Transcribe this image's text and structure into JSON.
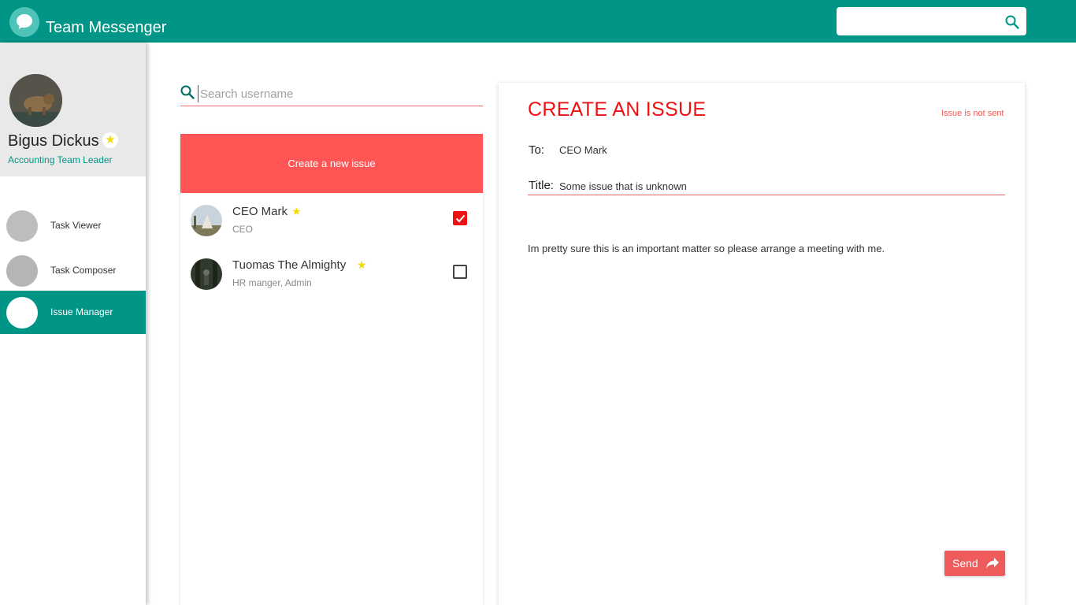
{
  "app": {
    "title": "Team Messenger",
    "icon": "chat-bubble-icon"
  },
  "header_search": {
    "placeholder": "",
    "icon": "search-icon"
  },
  "profile": {
    "name": "Bigus Dickus",
    "role": "Accounting Team Leader",
    "starred": true,
    "star_glyph": "★"
  },
  "nav": {
    "items": [
      {
        "label": "Task Viewer",
        "active": false
      },
      {
        "label": "Task Composer",
        "active": false
      },
      {
        "label": "Issue Manager",
        "active": true
      }
    ]
  },
  "user_search": {
    "placeholder": "Search username",
    "icon": "search-icon"
  },
  "create_button": {
    "label": "Create a new issue"
  },
  "users": [
    {
      "name": "CEO Mark",
      "role": "CEO",
      "starred": true,
      "checked": true,
      "star_glyph": "★"
    },
    {
      "name": "Tuomas The Almighty",
      "role": "HR manger, Admin",
      "starred": true,
      "checked": false,
      "star_glyph": "★"
    }
  ],
  "issue": {
    "heading": "CREATE AN ISSUE",
    "status": "Issue is not sent",
    "to_label": "To:",
    "to_value": "CEO Mark",
    "title_label": "Title:",
    "title_value": "Some issue that is unknown",
    "body": "Im pretty sure this is an important matter so please arrange a meeting with me.",
    "send_label": "Send",
    "send_icon": "share-arrow-icon"
  },
  "colors": {
    "primary": "#009587",
    "accent_red": "#ff5555",
    "heading_red": "#ee1111",
    "star": "#f5d90a"
  }
}
